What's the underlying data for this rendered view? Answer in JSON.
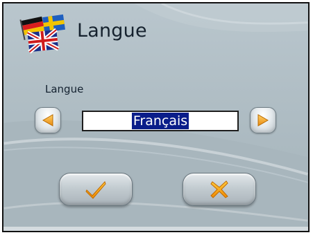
{
  "window": {
    "title": "Langue",
    "title_icon": "flags-icon"
  },
  "field": {
    "label": "Langue",
    "value": "Français",
    "prev_icon": "arrow-left-icon",
    "next_icon": "arrow-right-icon"
  },
  "actions": {
    "confirm_icon": "checkmark-icon",
    "cancel_icon": "cross-icon"
  },
  "colors": {
    "background": "#aebcc3",
    "arrow_orange": "#f0a020",
    "selection": "#0a1d8a"
  }
}
